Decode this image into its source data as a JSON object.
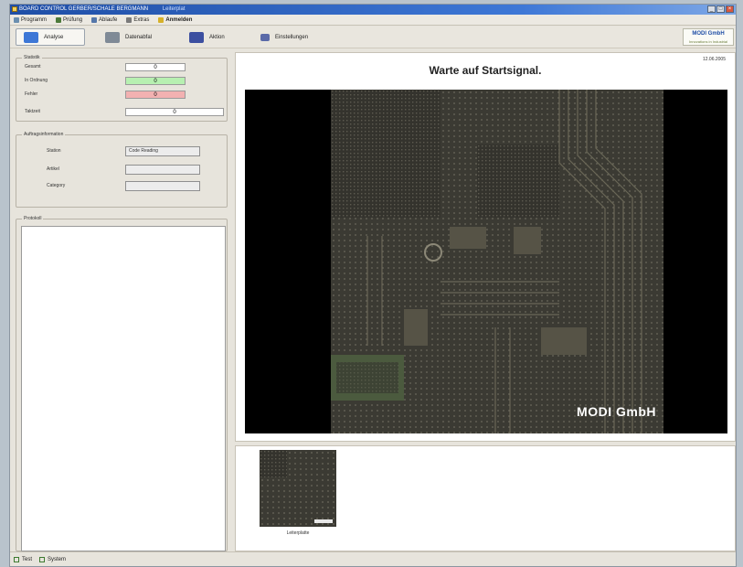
{
  "window": {
    "title": "BOARD CONTROL GERBER/SCHALE BERGMANN",
    "document": "Leiterplat",
    "controls": [
      "_",
      "□",
      "×"
    ]
  },
  "menu": [
    {
      "label": "Programm",
      "icon": "folder-icon",
      "color": "#6b8fb0"
    },
    {
      "label": "Prüfung",
      "icon": "check-icon",
      "color": "#4c7a3a"
    },
    {
      "label": "Ablaufe",
      "icon": "flow-icon",
      "color": "#5577aa"
    },
    {
      "label": "Extras",
      "icon": "wrench-icon",
      "color": "#7a7a7a"
    },
    {
      "label": "Anmelden",
      "icon": "key-icon",
      "color": "#d6b12a",
      "bold": true
    }
  ],
  "toolbar": {
    "buttons": [
      {
        "label": "Analyse",
        "icon": "magnifier-icon",
        "color": "#3d77d6",
        "active": true
      },
      {
        "label": "Datenabfal",
        "icon": "truck-icon",
        "color": "#7f8a96",
        "active": false
      },
      {
        "label": "Aktion",
        "icon": "floppy-icon",
        "color": "#3c4fa0",
        "active": false
      },
      {
        "label": "Einstellungen",
        "icon": "key-icon",
        "color": "#5a6aa8",
        "active": false
      }
    ],
    "logo": "MODI GmbH",
    "logo_tagline": "Innovations in Industrial"
  },
  "stats": {
    "group_title": "Statistik",
    "rows": [
      {
        "label": "Gesamt",
        "value": "0",
        "kind": "plain"
      },
      {
        "label": "In Ordnung",
        "value": "0",
        "kind": "ok"
      },
      {
        "label": "Fehler",
        "value": "0",
        "kind": "error"
      },
      {
        "label": "Taktzeit",
        "value": "0",
        "kind": "plain"
      }
    ]
  },
  "auftrag": {
    "group_title": "Auftragsinformation",
    "rows": [
      {
        "label": "Station",
        "value": "Code Reading"
      },
      {
        "label": "Artikel",
        "value": ""
      },
      {
        "label": "Category",
        "value": ""
      }
    ]
  },
  "protocol": {
    "group_title": "Protokoll"
  },
  "main": {
    "status_title": "Warte auf Startsignal.",
    "timestamp": "12.06.2005",
    "brand": "MODI GmbH"
  },
  "thumbnail": {
    "caption": "Leiterplatte"
  },
  "statusbar": [
    {
      "label": "Test"
    },
    {
      "label": "System"
    }
  ]
}
